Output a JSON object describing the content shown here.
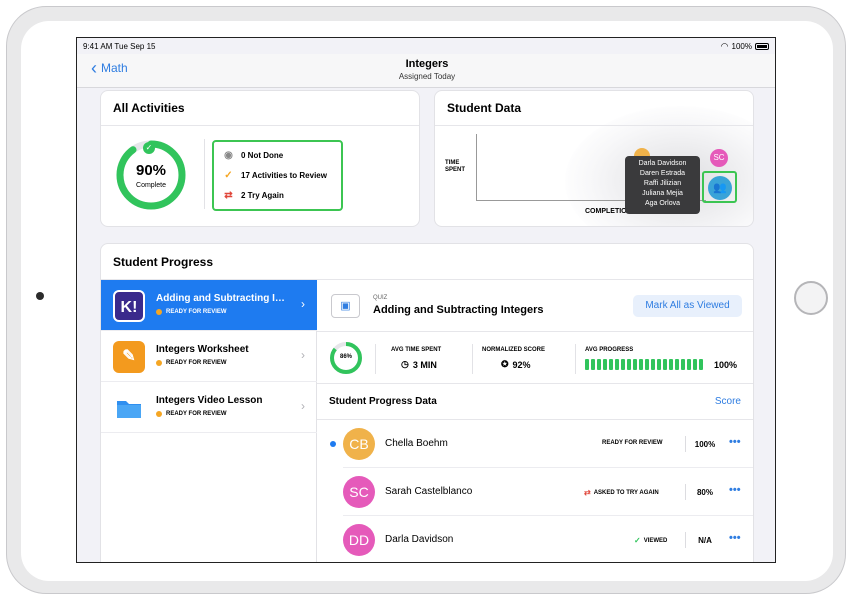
{
  "status_bar": {
    "time": "9:41 AM  Tue Sep 15",
    "battery": "100%"
  },
  "nav": {
    "back_label": "Math",
    "title": "Integers",
    "subtitle": "Assigned Today"
  },
  "all_activities": {
    "title": "All Activities",
    "percent": "90%",
    "percent_label": "Complete",
    "progress_fraction": 0.9,
    "summary": [
      {
        "icon": "person-icon",
        "label": "0 Not Done"
      },
      {
        "icon": "check-icon",
        "label": "17 Activities to Review"
      },
      {
        "icon": "repeat-icon",
        "label": "2 Try Again"
      }
    ]
  },
  "student_data": {
    "title": "Student Data",
    "y_label": "TIME\nSPENT",
    "x_label": "COMPLETION",
    "avatar_initials": "SC",
    "tooltip_names": [
      "Darla Davidson",
      "Daren Estrada",
      "Raffi Jilizian",
      "Juliana Mejia",
      "Aga Orlova"
    ]
  },
  "student_progress": {
    "title": "Student Progress",
    "activities": [
      {
        "name": "Adding and Subtracting Integers",
        "status": "READY FOR REVIEW",
        "icon_text": "K!",
        "icon_color": "#3a2a8c",
        "selected": true
      },
      {
        "name": "Integers Worksheet",
        "status": "READY FOR REVIEW",
        "icon_text": "✎",
        "icon_color": "#f39a1e",
        "selected": false
      },
      {
        "name": "Integers Video Lesson",
        "status": "READY FOR REVIEW",
        "icon_text": "",
        "icon_color": "#2f8ff0",
        "selected": false
      }
    ],
    "detail": {
      "kind": "QUIZ",
      "name": "Adding and Subtracting Integers",
      "mark_all_label": "Mark All as Viewed",
      "ring_percent": "86%",
      "ring_fraction": 0.86,
      "avg_time_head": "AVG TIME SPENT",
      "avg_time_val": "3 MIN",
      "norm_score_head": "NORMALIZED SCORE",
      "norm_score_val": "92%",
      "avg_progress_head": "AVG PROGRESS",
      "avg_progress_val": "100%",
      "avg_progress_fraction": 1.0,
      "data_title": "Student Progress Data",
      "score_label": "Score",
      "students": [
        {
          "initials": "CB",
          "name": "Chella Boehm",
          "status": "READY FOR REVIEW",
          "status_icon": "",
          "score": "100%",
          "color": "#f0b24a",
          "new": true
        },
        {
          "initials": "SC",
          "name": "Sarah Castelblanco",
          "status": "ASKED TO TRY AGAIN",
          "status_icon": "repeat-icon",
          "score": "80%",
          "color": "#e55aba",
          "new": false
        },
        {
          "initials": "DD",
          "name": "Darla Davidson",
          "status": "VIEWED",
          "status_icon": "check-icon",
          "score": "N/A",
          "color": "#e55aba",
          "new": false
        }
      ]
    }
  }
}
